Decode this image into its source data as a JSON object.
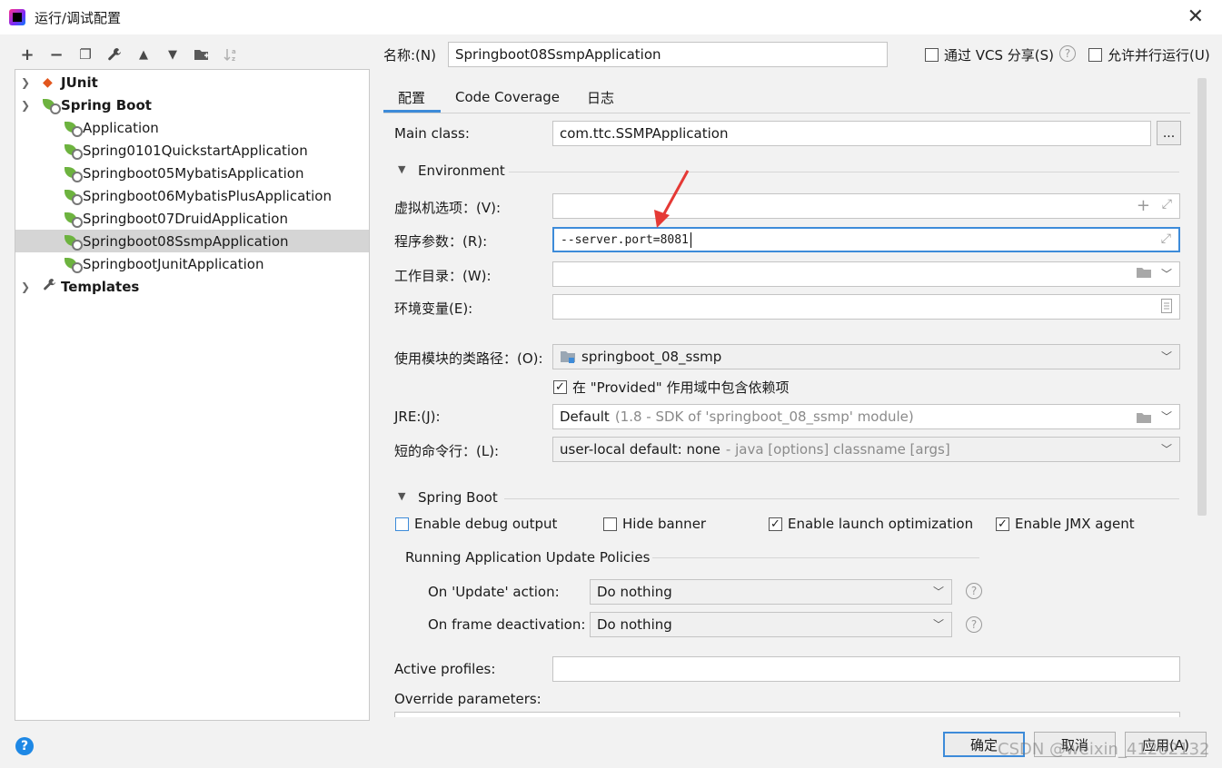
{
  "window": {
    "title": "运行/调试配置",
    "close_glyph": "✕"
  },
  "toolbar": {
    "add": "+",
    "remove": "−",
    "copy": "❐",
    "edit": "🔧",
    "up": "▲",
    "down": "▼",
    "folder": "📁",
    "sort": "↓"
  },
  "tree": {
    "junit": "JUnit",
    "spring_boot": "Spring Boot",
    "items": [
      "Application",
      "Spring0101QuickstartApplication",
      "Springboot05MybatisApplication",
      "Springboot06MybatisPlusApplication",
      "Springboot07DruidApplication",
      "Springboot08SsmpApplication",
      "SpringbootJunitApplication"
    ],
    "templates": "Templates"
  },
  "header": {
    "name_label": "名称:(N)",
    "name_value": "Springboot08SsmpApplication",
    "share_vcs": "通过 VCS 分享(S)",
    "allow_parallel": "允许并行运行(U)"
  },
  "tabs": [
    "配置",
    "Code Coverage",
    "日志"
  ],
  "config": {
    "main_class_label": "Main class:",
    "main_class_value": "com.ttc.SSMPApplication",
    "environment": "Environment",
    "vm_options_label": "虚拟机选项：(V):",
    "program_args_label": "程序参数：(R):",
    "program_args_value": "--server.port=8081",
    "working_dir_label": "工作目录：(W):",
    "env_vars_label": "环境变量(E):",
    "module_classpath_label": "使用模块的类路径：(O):",
    "module_value": "springboot_08_ssmp",
    "provided_scope": "在 \"Provided\" 作用域中包含依赖项",
    "jre_label": "JRE:(J):",
    "jre_value": "Default",
    "jre_detail": "(1.8 - SDK of 'springboot_08_ssmp' module)",
    "shorten_cmd_label": "短的命令行：(L):",
    "shorten_cmd_value": "user-local default: none",
    "shorten_cmd_detail": "- java [options] classname [args]"
  },
  "spring": {
    "section": "Spring Boot",
    "debug_output": "Enable debug output",
    "hide_banner": "Hide banner",
    "launch_opt": "Enable launch optimization",
    "jmx_agent": "Enable JMX agent",
    "policies": "Running Application Update Policies",
    "on_update_label": "On 'Update' action:",
    "on_update_value": "Do nothing",
    "on_frame_label": "On frame deactivation:",
    "on_frame_value": "Do nothing",
    "active_profiles_label": "Active profiles:",
    "override_params_label": "Override parameters:"
  },
  "footer": {
    "ok": "确定",
    "cancel": "取消",
    "apply": "应用(A)",
    "help": "?"
  },
  "watermark": "CSDN @weixin_41262132",
  "colors": {
    "accent": "#3d8bd9",
    "spring_green": "#6db33f",
    "arrow_red": "#e53935"
  }
}
